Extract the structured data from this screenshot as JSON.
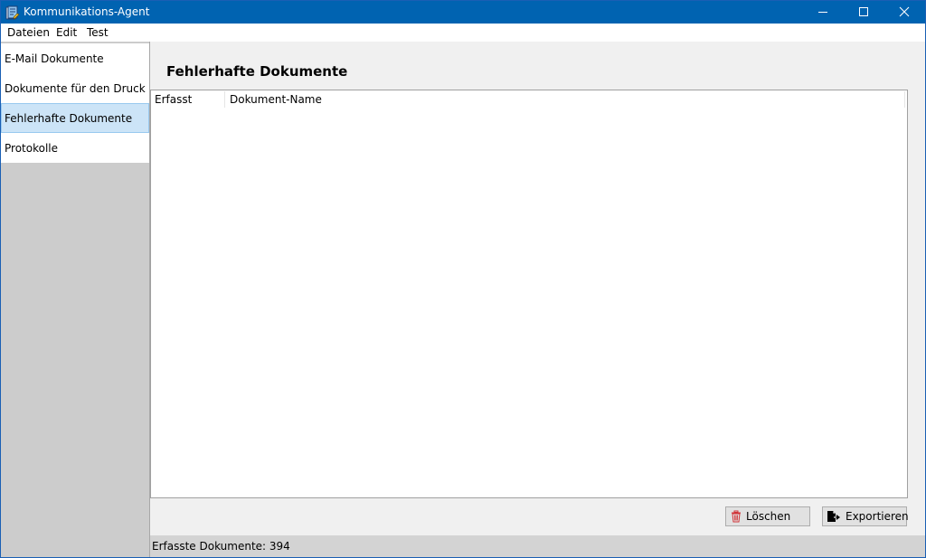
{
  "window": {
    "title": "Kommunikations-Agent",
    "icon": "app-icon",
    "titlebar_color": "#0063b1",
    "controls": [
      "minimize-icon",
      "maximize-icon",
      "close-icon"
    ]
  },
  "menu": {
    "items": [
      {
        "label": "Dateien"
      },
      {
        "label": "Edit"
      },
      {
        "label": "Test"
      }
    ]
  },
  "sidebar": {
    "items": [
      {
        "label": "E-Mail Dokumente",
        "selected": false
      },
      {
        "label": "Dokumente für den Druck",
        "selected": false
      },
      {
        "label": "Fehlerhafte Dokumente",
        "selected": true
      },
      {
        "label": "Protokolle",
        "selected": false
      }
    ],
    "selected_color": "#cce4f7"
  },
  "main": {
    "title": "Fehlerhafte Dokumente",
    "table": {
      "columns": [
        "Erfasst",
        "Dokument-Name"
      ],
      "rows": []
    },
    "buttons": {
      "delete_label": "Löschen",
      "delete_icon": "trash-icon",
      "export_label": "Exportieren",
      "export_icon": "export-icon"
    }
  },
  "status": {
    "text": "Erfasste Dokumente: 394"
  }
}
